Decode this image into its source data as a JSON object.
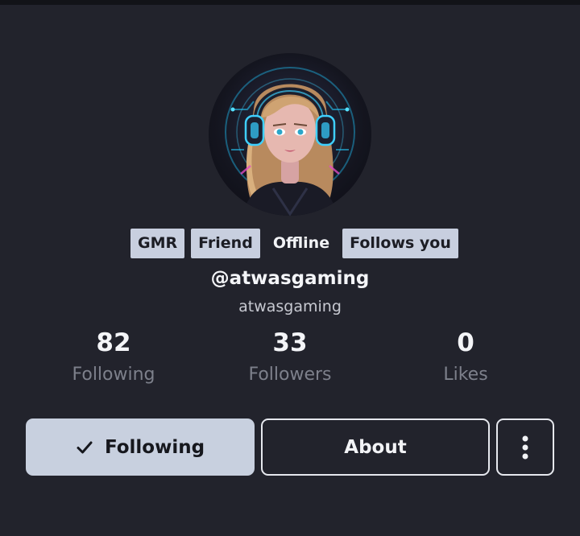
{
  "profile": {
    "avatar_icon": "gamer-girl-headphones-avatar",
    "badges": [
      "GMR",
      "Friend"
    ],
    "status": "Offline",
    "follows_badge": "Follows you",
    "handle": "@atwasgaming",
    "username": "atwasgaming"
  },
  "stats": [
    {
      "value": "82",
      "label": "Following"
    },
    {
      "value": "33",
      "label": "Followers"
    },
    {
      "value": "0",
      "label": "Likes"
    }
  ],
  "actions": {
    "following_label": "Following",
    "following_icon": "check-icon",
    "about_label": "About",
    "more_icon": "vertical-dots-icon"
  },
  "colors": {
    "background": "#22232c",
    "badge": "#c8cfdf",
    "primary_button": "#c8d0df",
    "muted_text": "#7d808b"
  }
}
